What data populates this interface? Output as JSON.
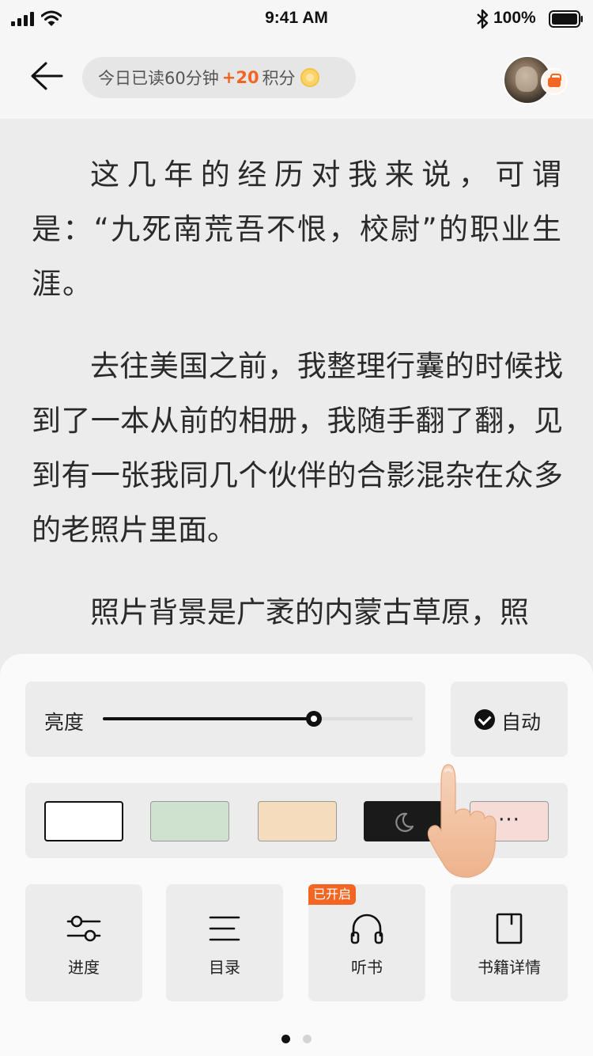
{
  "status_bar": {
    "time": "9:41 AM",
    "battery": "100%",
    "icons": [
      "signal-icon",
      "wifi-icon",
      "bluetooth-icon",
      "battery-icon"
    ]
  },
  "header": {
    "back_icon": "arrow-left-icon",
    "reading_pill": {
      "prefix": "今日已读60分钟",
      "points": "+20",
      "suffix": "积分",
      "icon": "coin-icon"
    },
    "avatar_badge_icon": "gift-icon"
  },
  "content": {
    "paragraphs": [
      "这几年的经历对我来说，可谓是：“九死南荒吾不恨，校尉”的职业生涯。",
      "去往美国之前，我整理行囊的时候找到了一本从前的相册，我随手翻了翻，见到有一张我同几个伙伴的合影混杂在众多的老照片里面。",
      "照片背景是广袤的内蒙古草原，照"
    ]
  },
  "panel": {
    "brightness": {
      "label": "亮度",
      "level": 0.68
    },
    "auto": {
      "label": "自动",
      "checked": true
    },
    "themes": [
      {
        "name": "white",
        "color": "#ffffff",
        "selected": true
      },
      {
        "name": "green",
        "color": "#cfe2d0"
      },
      {
        "name": "beige",
        "color": "#f4dcbc"
      },
      {
        "name": "night",
        "color": "#1a1a1a",
        "icon": "moon-icon"
      },
      {
        "name": "more",
        "color": "#f5dcd6",
        "label": "···"
      }
    ],
    "menu": [
      {
        "label": "进度",
        "icon": "sliders-icon"
      },
      {
        "label": "目录",
        "icon": "list-icon"
      },
      {
        "label": "听书",
        "icon": "headphones-icon",
        "badge": "已开启"
      },
      {
        "label": "书籍详情",
        "icon": "bookmark-icon"
      }
    ],
    "pages": {
      "count": 2,
      "current": 1
    }
  },
  "colors": {
    "accent": "#f26522",
    "page_background": "#ececec",
    "panel_background": "#fafafa",
    "card_background": "#ececec",
    "text": "#222222"
  },
  "overlay": {
    "hint": "tap-hand-icon"
  }
}
